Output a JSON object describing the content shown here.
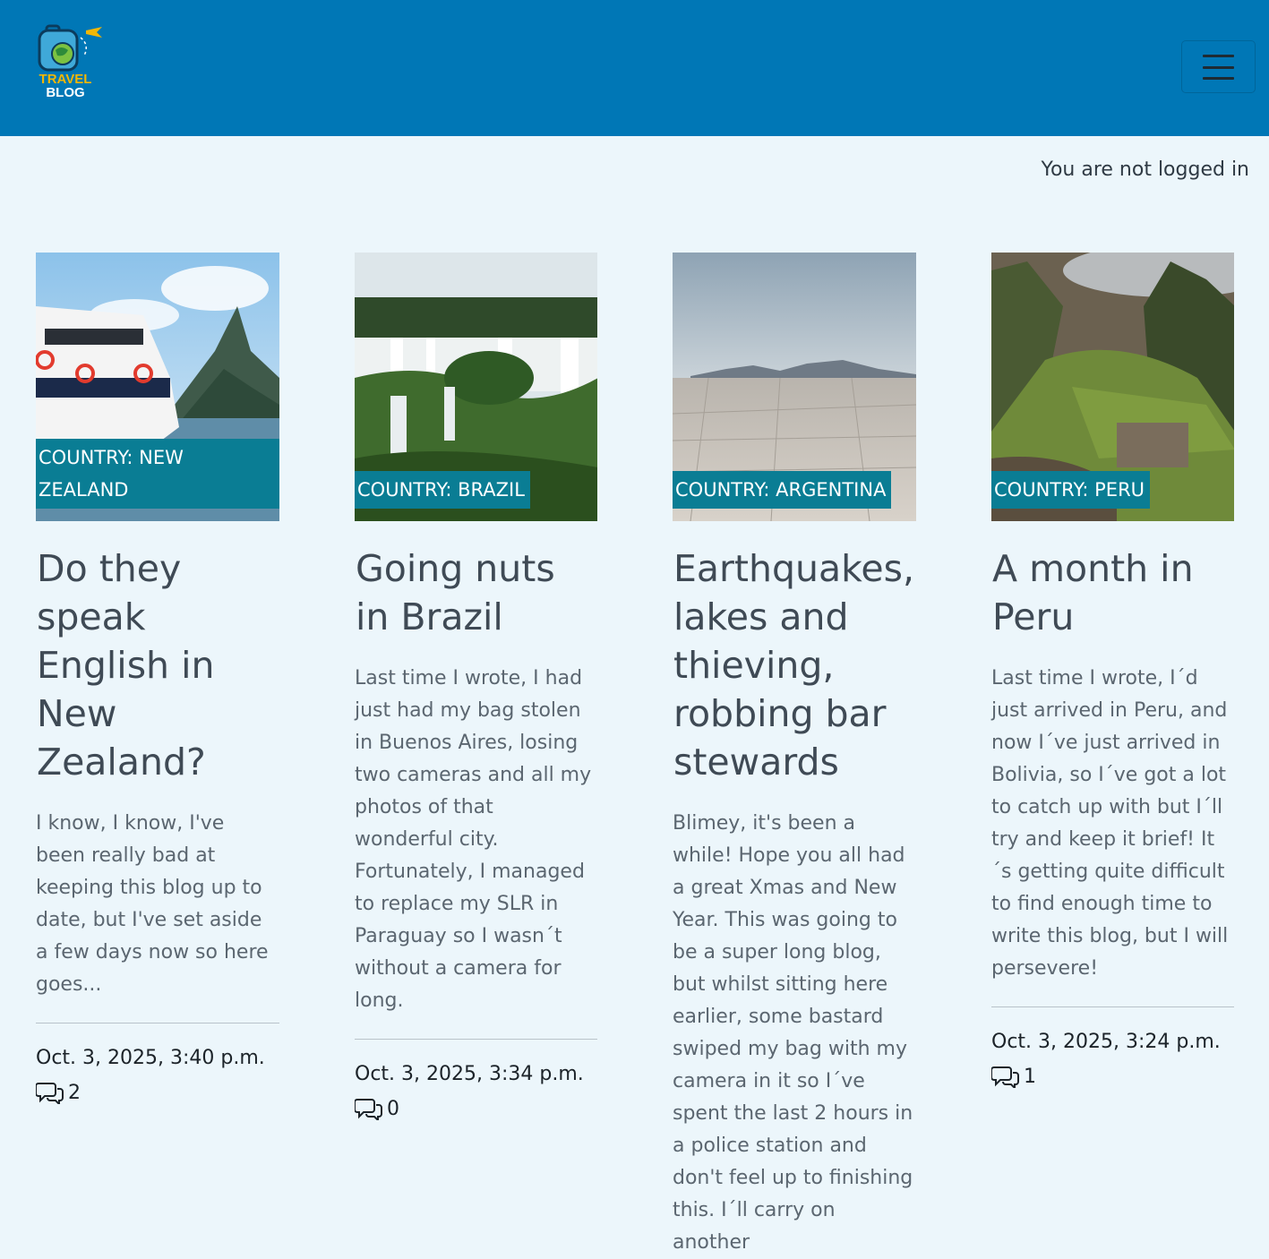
{
  "brand": {
    "line1": "TRAVEL",
    "line2": "BLOG"
  },
  "colors": {
    "navbar": "#0077b6",
    "badge": "#0a7d94",
    "background": "#ecf6fb"
  },
  "nav": {
    "toggler_icon": "hamburger-icon"
  },
  "status_text": "You are not logged in",
  "posts": [
    {
      "country": "COUNTRY: NEW ZEALAND",
      "title": "Do they speak English in New Zealand?",
      "excerpt": "I know, I know, I've been really bad at keeping this blog up to date, but I've set aside a few days now so here goes...",
      "date": "Oct. 3, 2025, 3:40 p.m.",
      "comments": "2"
    },
    {
      "country": "COUNTRY: BRAZIL",
      "title": "Going nuts in Brazil",
      "excerpt": "Last time I wrote, I had just had my bag stolen in Buenos Aires, losing two cameras and all my photos of that wonderful city. Fortunately, I managed to replace my SLR in Paraguay so I wasn´t without a camera for long.",
      "date": "Oct. 3, 2025, 3:34 p.m.",
      "comments": "0"
    },
    {
      "country": "COUNTRY: ARGENTINA",
      "title": "Earthquakes, lakes and thieving, robbing bar stewards",
      "excerpt": "Blimey, it's been a while! Hope you all had a great Xmas and New Year. This was going to be a super long blog, but whilst sitting here earlier, some bastard swiped my bag with my camera in it so I´ve spent the last 2 hours in a police station and don't feel up to finishing this. I´ll carry on another",
      "date": "",
      "comments": ""
    },
    {
      "country": "COUNTRY: PERU",
      "title": "A month in Peru",
      "excerpt": "Last time I wrote, I´d just arrived in Peru, and now I´ve just arrived in Bolivia, so I´ve got a lot to catch up with but I´ll try and keep it brief! It´s getting quite difficult to find enough time to write this blog, but I will persevere!",
      "date": "Oct. 3, 2025, 3:24 p.m.",
      "comments": "1"
    }
  ]
}
